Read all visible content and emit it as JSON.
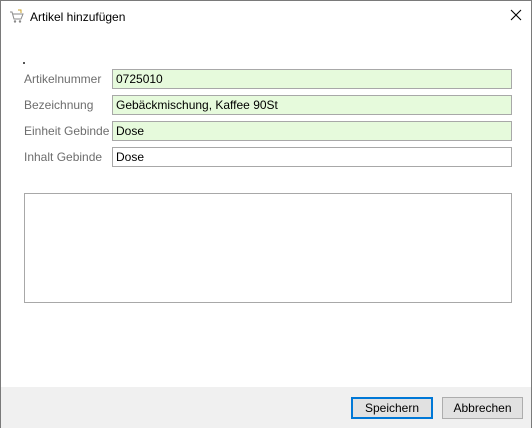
{
  "window": {
    "title": "Artikel hinzufügen"
  },
  "icons": {
    "app": "cart-icon",
    "close": "close-icon"
  },
  "form": {
    "fields": [
      {
        "label": "Artikelnummer",
        "value": "0725010"
      },
      {
        "label": "Bezeichnung",
        "value": "Gebäckmischung, Kaffee 90St"
      },
      {
        "label": "Einheit Gebinde",
        "value": "Dose"
      },
      {
        "label": "Inhalt Gebinde",
        "value": "Dose"
      }
    ],
    "memo": ""
  },
  "buttons": {
    "save": "Speichern",
    "cancel": "Abbrechen"
  },
  "colors": {
    "required_field_bg": "#e6fadc",
    "focus_border": "#0078d7"
  }
}
